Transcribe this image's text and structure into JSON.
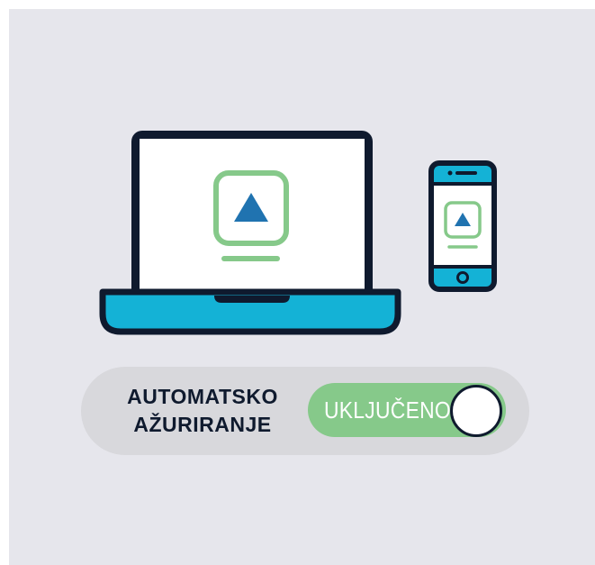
{
  "setting": {
    "label_line1": "AUTOMATSKO",
    "label_line2": "AŽURIRANJE",
    "toggle_state": "UKLJUČENO"
  },
  "icons": {
    "laptop": "laptop-icon",
    "phone": "smartphone-icon",
    "update": "update-arrow-icon"
  },
  "colors": {
    "background": "#e6e6ec",
    "outline": "#0f1a2e",
    "device_accent": "#14b2d6",
    "update_frame": "#86c98a",
    "arrow": "#2073b0",
    "toggle_on": "#86c98a"
  }
}
